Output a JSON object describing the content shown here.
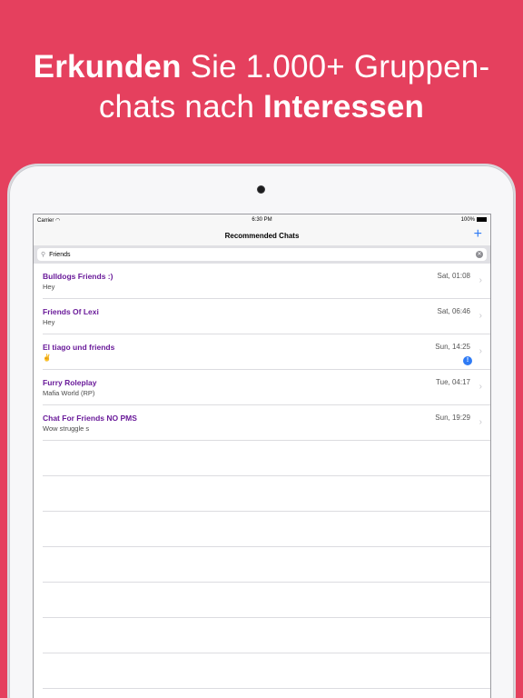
{
  "promo": {
    "line1_bold": "Erkunden",
    "line1_rest": " Sie 1.000+ Gruppen-",
    "line2_rest": "chats nach ",
    "line2_bold": "Interessen"
  },
  "status_bar": {
    "carrier": "Carrier",
    "time": "6:30 PM",
    "battery": "100%"
  },
  "nav": {
    "title": "Recommended Chats",
    "add_icon": "+"
  },
  "search": {
    "value": "Friends"
  },
  "chats": [
    {
      "name": "Bulldogs Friends :)",
      "preview": "Hey",
      "time": "Sat, 01:08"
    },
    {
      "name": "Friends Of Lexi",
      "preview": "Hey",
      "time": "Sat, 06:46"
    },
    {
      "name": "El tiago und friends",
      "preview": "✌",
      "time": "Sun, 14:25",
      "badge": "!"
    },
    {
      "name": "Furry Roleplay",
      "preview": "Mafia World (RP)",
      "time": "Tue, 04:17"
    },
    {
      "name": "Chat For Friends NO PMS",
      "preview": "Wow struggle s",
      "time": "Sun, 19:29"
    }
  ],
  "colors": {
    "background": "#e5405e",
    "chat_name": "#6a1b9a",
    "accent": "#2f7bf5"
  }
}
